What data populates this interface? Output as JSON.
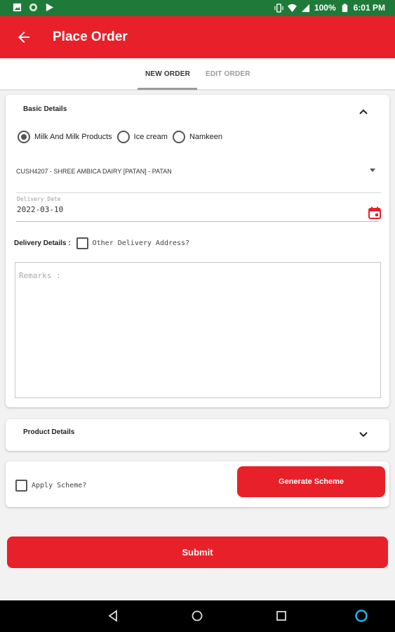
{
  "status_bar": {
    "battery": "100%",
    "time": "6:01 PM"
  },
  "app_bar": {
    "title": "Place Order"
  },
  "tabs": [
    {
      "label": "NEW ORDER",
      "active": true
    },
    {
      "label": "EDIT ORDER",
      "active": false
    }
  ],
  "basic_details": {
    "title": "Basic Details",
    "expanded": true,
    "categories": [
      {
        "label": "Milk And Milk Products",
        "selected": true
      },
      {
        "label": "Ice cream",
        "selected": false
      },
      {
        "label": "Namkeen",
        "selected": false
      }
    ],
    "customer": "CUSH4207 - SHREE AMBICA DAIRY [PATAN] - PATAN",
    "delivery_date_label": "Delivery Date",
    "delivery_date_value": "2022-03-10",
    "delivery_details_label": "Delivery Details :",
    "other_address_label": "Other Delivery Address?",
    "other_address_checked": false,
    "remarks_placeholder": "Remarks :"
  },
  "product_details": {
    "title": "Product Details",
    "expanded": false
  },
  "scheme": {
    "apply_label": "Apply Scheme?",
    "apply_checked": false,
    "generate_label": "Generate Scheme"
  },
  "submit_label": "Submit",
  "colors": {
    "accent": "#e8202a",
    "status_bar": "#1f7a3a"
  }
}
